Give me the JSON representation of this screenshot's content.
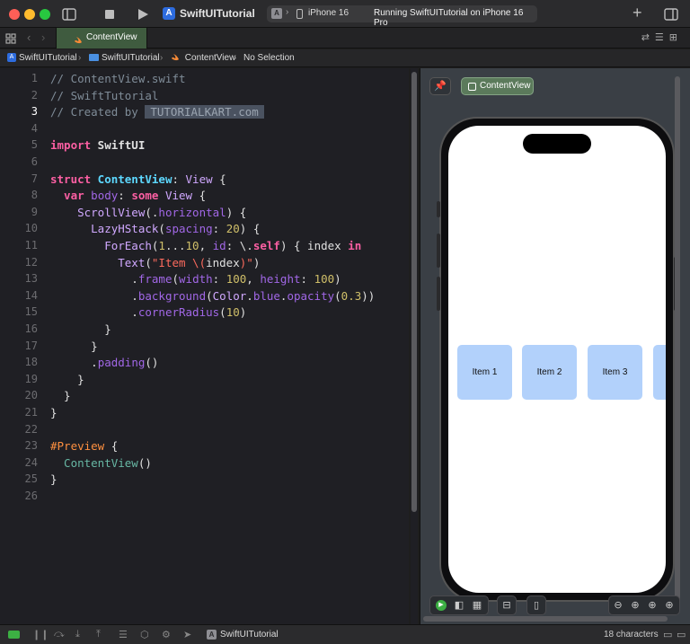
{
  "titlebar": {
    "app_title": "SwiftUITutorial",
    "device": "iPhone 16",
    "status": "Running SwiftUITutorial on iPhone 16 Pro"
  },
  "tab": {
    "label": "ContentView"
  },
  "jumpbar": {
    "project": "SwiftUITutorial",
    "group": "SwiftUITutorial",
    "file": "ContentView",
    "selection": "No Selection"
  },
  "editor": {
    "line_numbers": [
      "1",
      "2",
      "3",
      "4",
      "5",
      "6",
      "7",
      "8",
      "9",
      "10",
      "11",
      "12",
      "13",
      "14",
      "15",
      "16",
      "17",
      "18",
      "19",
      "20",
      "21",
      "22",
      "23",
      "24",
      "25",
      "26"
    ],
    "active_line": 3
  },
  "code": {
    "l1": "// ContentView.swift",
    "l2": "// SwiftTutorial",
    "l3a": "// Created by ",
    "l3b": "TUTORIALKART.com",
    "l5a": "import",
    "l5b": " SwiftUI",
    "l7a": "struct",
    "l7b": " ContentView",
    "l7c": ": ",
    "l7d": "View",
    "l7e": " {",
    "l8a": "  var",
    "l8b": " body",
    "l8c": ": ",
    "l8d": "some",
    "l8e": " ",
    "l8f": "View",
    "l8g": " {",
    "l9a": "    ScrollView",
    "l9b": "(.",
    "l9c": "horizontal",
    "l9d": ") {",
    "l10a": "      LazyHStack",
    "l10b": "(",
    "l10c": "spacing",
    "l10d": ": ",
    "l10e": "20",
    "l10f": ") {",
    "l11a": "        ForEach",
    "l11b": "(",
    "l11c": "1",
    "l11d": "...",
    "l11e": "10",
    "l11f": ", ",
    "l11g": "id",
    "l11h": ": \\.",
    "l11i": "self",
    "l11j": ") { index ",
    "l11k": "in",
    "l12a": "          Text",
    "l12b": "(",
    "l12c": "\"Item \\(",
    "l12d": "index",
    "l12e": ")\"",
    "l12f": ")",
    "l13a": "            .",
    "l13b": "frame",
    "l13c": "(",
    "l13d": "width",
    "l13e": ": ",
    "l13f": "100",
    "l13g": ", ",
    "l13h": "height",
    "l13i": ": ",
    "l13j": "100",
    "l13k": ")",
    "l14a": "            .",
    "l14b": "background",
    "l14c": "(",
    "l14d": "Color",
    "l14e": ".",
    "l14f": "blue",
    "l14g": ".",
    "l14h": "opacity",
    "l14i": "(",
    "l14j": "0.3",
    "l14k": "))",
    "l15a": "            .",
    "l15b": "cornerRadius",
    "l15c": "(",
    "l15d": "10",
    "l15e": ")",
    "l16": "        }",
    "l17": "      }",
    "l18a": "      .",
    "l18b": "padding",
    "l18c": "()",
    "l19": "    }",
    "l20": "  }",
    "l21": "}",
    "l23a": "#Preview",
    "l23b": " {",
    "l24a": "  ContentView",
    "l24b": "()",
    "l25": "}"
  },
  "preview": {
    "pill_label": "ContentView",
    "items": [
      "Item 1",
      "Item 2",
      "Item 3"
    ]
  },
  "debugbar": {
    "target": "SwiftUITutorial",
    "char_count": "18 characters"
  }
}
